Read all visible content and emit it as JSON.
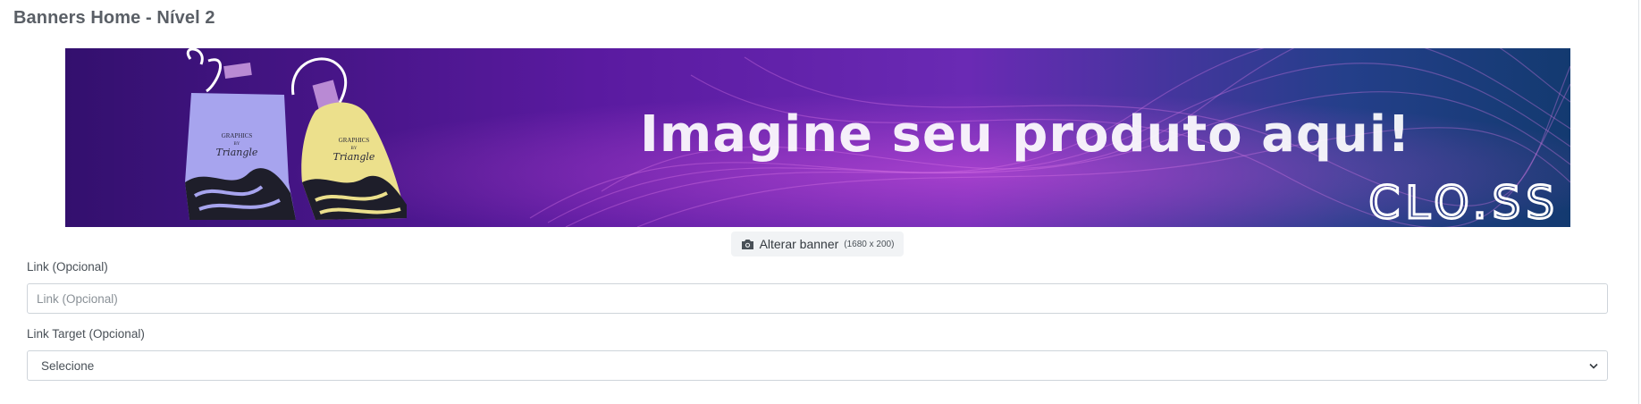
{
  "page": {
    "title": "Banners Home - Nível 2"
  },
  "banner": {
    "headline": "Imagine seu produto aqui!",
    "brand": "CLO.SS",
    "bag_print_top": "GRAPHICS",
    "bag_print_mid": "BY",
    "bag_print_script": "Triangle"
  },
  "change_banner": {
    "label": "Alterar banner",
    "hint": "(1680 x 200)",
    "icon": "camera-icon"
  },
  "link_field": {
    "label": "Link (Opcional)",
    "value": "",
    "placeholder": "Link (Opcional)"
  },
  "target_field": {
    "label": "Link Target (Opcional)",
    "selected": "Selecione",
    "icon": "chevron-down-icon"
  },
  "colors": {
    "banner_left": "#3a0f7a",
    "banner_mid": "#7a1fb0",
    "banner_right": "#123a78",
    "bag_blue": "#a7a4ee",
    "bag_yellow": "#ece08c"
  }
}
